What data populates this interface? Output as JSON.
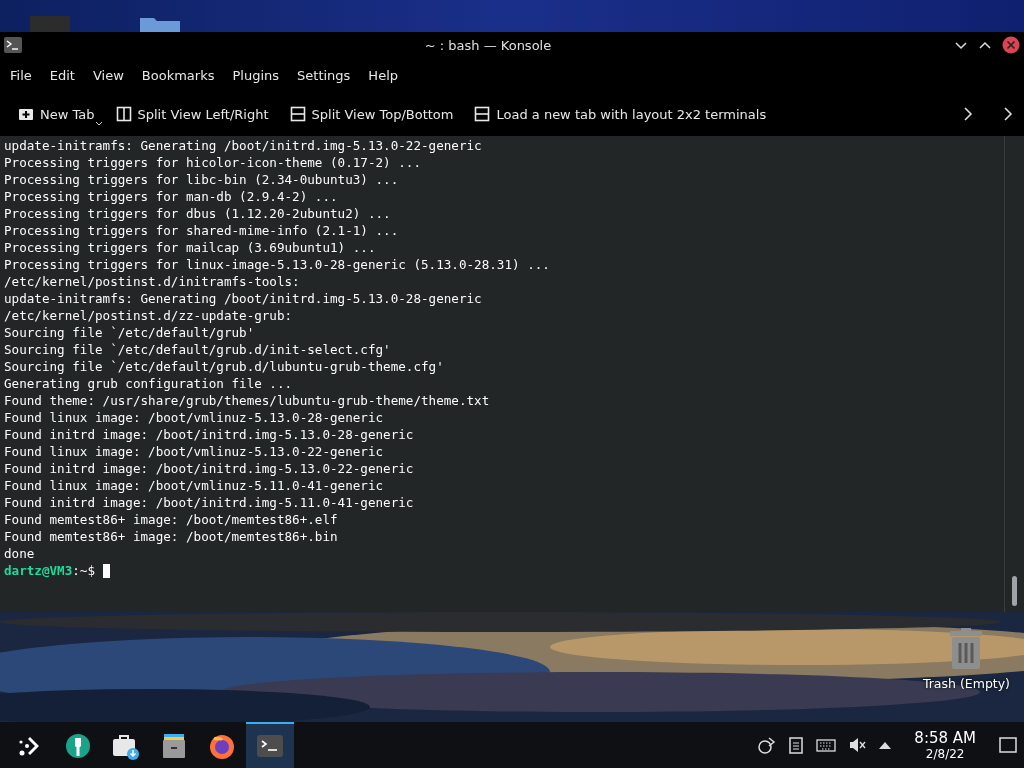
{
  "window": {
    "title": "~ : bash — Konsole"
  },
  "menu": [
    "File",
    "Edit",
    "View",
    "Bookmarks",
    "Plugins",
    "Settings",
    "Help"
  ],
  "toolbar": [
    {
      "kind": "new-tab",
      "label": "New Tab"
    },
    {
      "kind": "split-lr",
      "label": "Split View Left/Right"
    },
    {
      "kind": "split-tb",
      "label": "Split View Top/Bottom"
    },
    {
      "kind": "split-tb",
      "label": "Load a new tab with layout 2x2 terminals"
    }
  ],
  "terminal": {
    "lines": [
      "update-initramfs: Generating /boot/initrd.img-5.13.0-22-generic",
      "Processing triggers for hicolor-icon-theme (0.17-2) ...",
      "Processing triggers for libc-bin (2.34-0ubuntu3) ...",
      "Processing triggers for man-db (2.9.4-2) ...",
      "Processing triggers for dbus (1.12.20-2ubuntu2) ...",
      "Processing triggers for shared-mime-info (2.1-1) ...",
      "Processing triggers for mailcap (3.69ubuntu1) ...",
      "Processing triggers for linux-image-5.13.0-28-generic (5.13.0-28.31) ...",
      "/etc/kernel/postinst.d/initramfs-tools:",
      "update-initramfs: Generating /boot/initrd.img-5.13.0-28-generic",
      "/etc/kernel/postinst.d/zz-update-grub:",
      "Sourcing file `/etc/default/grub'",
      "Sourcing file `/etc/default/grub.d/init-select.cfg'",
      "Sourcing file `/etc/default/grub.d/lubuntu-grub-theme.cfg'",
      "Generating grub configuration file ...",
      "Found theme: /usr/share/grub/themes/lubuntu-grub-theme/theme.txt",
      "Found linux image: /boot/vmlinuz-5.13.0-28-generic",
      "Found initrd image: /boot/initrd.img-5.13.0-28-generic",
      "Found linux image: /boot/vmlinuz-5.13.0-22-generic",
      "Found initrd image: /boot/initrd.img-5.13.0-22-generic",
      "Found linux image: /boot/vmlinuz-5.11.0-41-generic",
      "Found initrd image: /boot/initrd.img-5.11.0-41-generic",
      "Found memtest86+ image: /boot/memtest86+.elf",
      "Found memtest86+ image: /boot/memtest86+.bin",
      "done"
    ],
    "prompt": {
      "user_host": "dartz@VM3",
      "path": ":~$"
    }
  },
  "desktop": {
    "trash_label": "Trash (Empty)"
  },
  "taskbar": {
    "apps": [
      {
        "kind": "launcher",
        "selected": false
      },
      {
        "kind": "settings",
        "selected": false
      },
      {
        "kind": "store",
        "selected": false
      },
      {
        "kind": "files",
        "selected": false
      },
      {
        "kind": "browser",
        "selected": false
      },
      {
        "kind": "terminal",
        "selected": true
      }
    ],
    "volume": {
      "muted": true
    },
    "clock": {
      "time": "8:58 AM",
      "date": "2/8/22"
    }
  }
}
